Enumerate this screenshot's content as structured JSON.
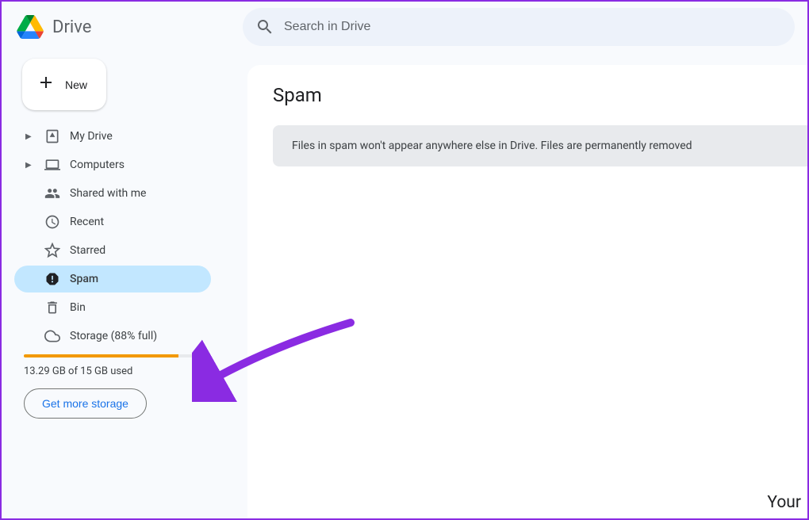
{
  "header": {
    "app_title": "Drive",
    "search_placeholder": "Search in Drive"
  },
  "sidebar": {
    "new_label": "New",
    "items": [
      {
        "label": "My Drive",
        "expandable": true
      },
      {
        "label": "Computers",
        "expandable": true
      },
      {
        "label": "Shared with me",
        "expandable": false
      },
      {
        "label": "Recent",
        "expandable": false
      },
      {
        "label": "Starred",
        "expandable": false
      },
      {
        "label": "Spam",
        "expandable": false,
        "active": true
      },
      {
        "label": "Bin",
        "expandable": false
      },
      {
        "label": "Storage (88% full)",
        "expandable": false
      }
    ],
    "storage": {
      "percent": 88,
      "used_text": "13.29 GB of 15 GB used",
      "cta_label": "Get more storage"
    }
  },
  "main": {
    "title": "Spam",
    "banner_text": "Files in spam won't appear anywhere else in Drive. Files are permanently removed",
    "corner_text": "Your"
  },
  "colors": {
    "accent": "#1a73e8",
    "warning": "#f29900",
    "active_bg": "#c2e7ff"
  }
}
